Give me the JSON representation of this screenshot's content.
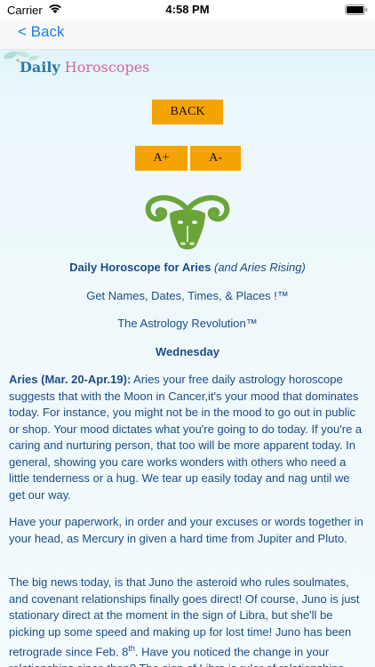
{
  "status_bar": {
    "carrier": "Carrier",
    "time": "4:58 PM"
  },
  "nav": {
    "back_label": "< Back"
  },
  "banner": {
    "title_word1": "Daily",
    "title_word2": "Horoscopes"
  },
  "controls": {
    "back_button": "BACK",
    "increase_font": "A+",
    "decrease_font": "A-"
  },
  "horoscope": {
    "title_bold": "Daily Horoscope for Aries",
    "title_italic": "(and Aries Rising)",
    "get_names": "Get Names, Dates, Times, & Places !™",
    "astrology_revolution": "The Astrology Revolution™",
    "weekday": "Wednesday",
    "p1_sign": "Aries (Mar. 20-Apr.19):",
    "p1_text": " Aries your free daily astrology horoscope suggests that with the Moon in Cancer,it's your mood that dominates today. For instance, you might not be in the mood to go out in public or shop.  Your mood dictates what you're going to do today.  If you're a caring and nurturing person, that too will be more apparent today.  In general, showing you care works wonders with others who need a little tenderness or a hug.  We tear up easily today and nag until we get our way.",
    "p2_text": "Have your paperwork, in order and your excuses or words together in your head, as Mercury in given a hard time from Jupiter and Pluto.",
    "p3_text_a": "The big news today, is that Juno the asteroid who rules soulmates, and covenant relationships finally goes direct!  Of course, Juno is just stationary direct at the moment in the sign of Libra, but she'll be picking up some speed and making up for lost time!  Juno has been retrograde since Feb. 8",
    "p3_sup": "th",
    "p3_text_b": ".  Have you noticed the change in your relationships since then?  The sign of Libra is ruler of relationships"
  },
  "colors": {
    "button_fill": "#f5a300",
    "text_blue": "#1c4c85",
    "link_blue": "#147efb",
    "emblem_green": "#6aa53a"
  }
}
